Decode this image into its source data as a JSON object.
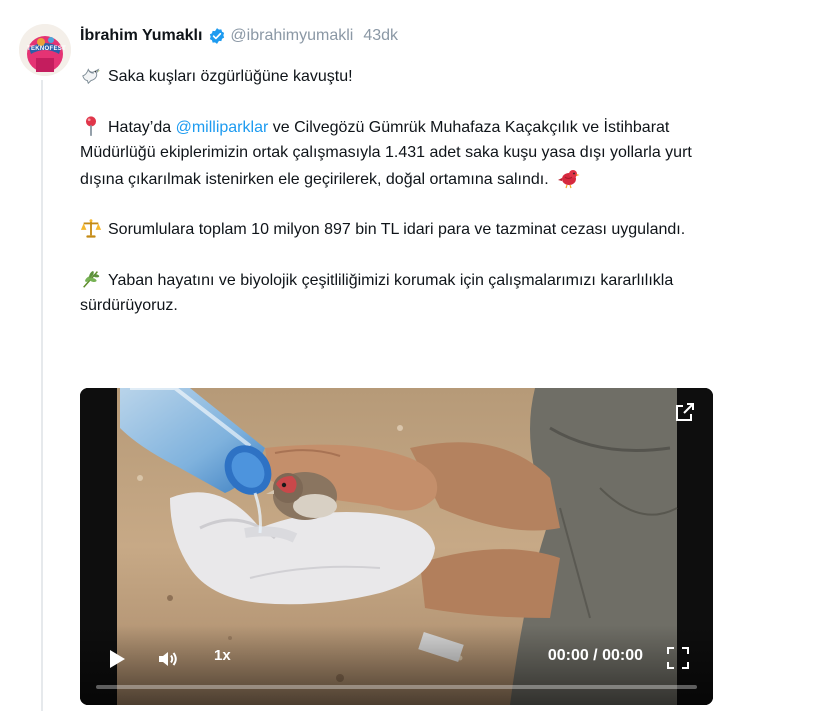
{
  "author": {
    "name": "İbrahim Yumaklı",
    "handle": "@ibrahimyumakli",
    "time": "43dk",
    "verified": true,
    "avatar_text": "TEKNOFEST"
  },
  "post": {
    "p1": "Saka kuşları özgürlüğüne kavuştu!",
    "p2_pre": "Hatay’da ",
    "p2_mention": "@milliparklar",
    "p2_post": " ve Cilvegözü Gümrük Muhafaza Kaçakçılık ve İstihbarat Müdürlüğü ekiplerimizin ortak çalışmasıyla 1.431 adet saka kuşu yasa dışı yollarla yurt dışına çıkarılmak istenirken ele geçirilerek, doğal ortamına salındı.",
    "p3": "Sorumlulara toplam 10 milyon 897 bin TL idari para ve tazminat cezası uygulandı.",
    "p4": "Yaban hayatını ve biyolojik çeşitliliğimizi korumak için çalışmalarımızı kararlılıkla sürdürüyoruz."
  },
  "icons": {
    "p1": "dove-icon",
    "p2": "round-pushpin-icon",
    "p2_end": "red-bird-icon",
    "p3": "balance-scale-icon",
    "p4": "herb-icon"
  },
  "video": {
    "speed": "1x",
    "time": "00:00 / 00:00",
    "progress": 0
  },
  "colors": {
    "link": "#1d9bf0",
    "verified": "#1d9bf0",
    "muted": "#8b98a5"
  }
}
